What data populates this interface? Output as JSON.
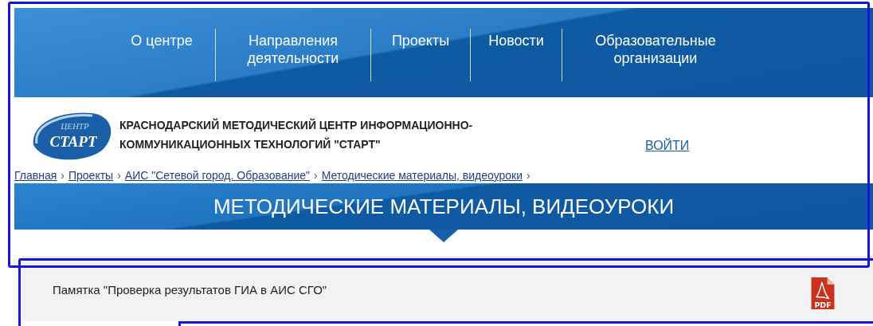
{
  "nav": [
    {
      "label": "О центре"
    },
    {
      "label": "Направления деятельности"
    },
    {
      "label": "Проекты"
    },
    {
      "label": "Новости"
    },
    {
      "label": "Образовательные организации"
    }
  ],
  "logo": {
    "top": "ЦЕНТР",
    "bottom": "СТАРТ"
  },
  "org_name": {
    "line_1": "КРАСНОДАРСКИЙ МЕТОДИЧЕСКИЙ ЦЕНТР ИНФОРМАЦИОННО-",
    "line_2": "КОММУНИКАЦИОННЫХ ТЕХНОЛОГИЙ \"СТАРТ\""
  },
  "login": "ВОЙТИ",
  "breadcrumb": {
    "separator": "›",
    "items": [
      {
        "label": "Главная"
      },
      {
        "label": "Проекты"
      },
      {
        "label": "АИС \"Сетевой город. Образование\""
      },
      {
        "label": "Методические материалы, видеоуроки"
      }
    ]
  },
  "page_title": "МЕТОДИЧЕСКИЕ МАТЕРИАЛЫ, ВИДЕОУРОКИ",
  "documents": [
    {
      "title": "Памятка \"Проверка результатов ГИА в АИС СГО\"",
      "file_type": "PDF"
    }
  ]
}
